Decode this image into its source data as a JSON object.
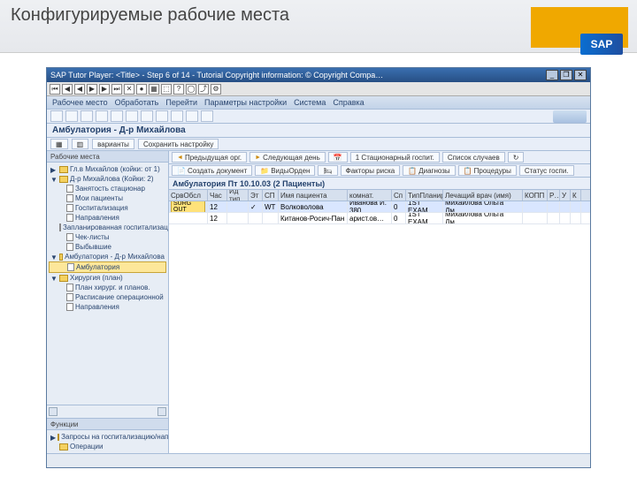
{
  "slide": {
    "title": "Конфигурируемые рабочие места",
    "brand": "SAP"
  },
  "titlebar": {
    "text": "SAP Tutor Player: <Title> - Step 6 of 14  -  Tutorial Copyright information: © Copyright Compa…",
    "min": "_",
    "max": "❐",
    "close": "✕"
  },
  "player_btns": [
    "⏮",
    "◀",
    "◀",
    "▶",
    "▶",
    "⏭",
    "✕",
    "●",
    "▦",
    "⬚",
    "?",
    "◯",
    "⤴",
    "⚙"
  ],
  "menu": [
    "Рабочее место",
    "Обработать",
    "Перейти",
    "Параметры настройки",
    "Система",
    "Справка"
  ],
  "doc_title": "Амбулатория - Д-р Михайлова",
  "extra_tb": {
    "var_label": "варианты",
    "settings_label": "Сохранить настройку"
  },
  "tree_upper_head": "Рабочие места",
  "tree_upper": [
    {
      "lvl": 0,
      "exp": "▶",
      "label": "Гл.в Михайлов (койки: от 1)"
    },
    {
      "lvl": 0,
      "exp": "▼",
      "label": "Д-р Михайлова (Койки: 2)"
    },
    {
      "lvl": 1,
      "exp": "",
      "label": "Занятость стационар"
    },
    {
      "lvl": 1,
      "exp": "",
      "label": "Мои пациенты"
    },
    {
      "lvl": 1,
      "exp": "",
      "label": "Госпитализация"
    },
    {
      "lvl": 1,
      "exp": "",
      "label": "Направления"
    },
    {
      "lvl": 1,
      "exp": "",
      "label": "Запланированная госпитализац."
    },
    {
      "lvl": 1,
      "exp": "",
      "label": "Чек-листы"
    },
    {
      "lvl": 1,
      "exp": "",
      "label": "Выбывшие"
    },
    {
      "lvl": 0,
      "exp": "▼",
      "label": "Амбулатория - Д-р Михайлова"
    },
    {
      "lvl": 1,
      "exp": "",
      "label": "Амбулатория",
      "sel": true
    },
    {
      "lvl": 0,
      "exp": "▼",
      "label": "Хирургия (план)"
    },
    {
      "lvl": 1,
      "exp": "",
      "label": "План хирург. и планов."
    },
    {
      "lvl": 1,
      "exp": "",
      "label": "Расписание операционной"
    },
    {
      "lvl": 1,
      "exp": "",
      "label": "Направления"
    }
  ],
  "tree_lower_head": "Функции",
  "tree_lower": [
    {
      "lvl": 0,
      "exp": "▶",
      "label": "Запросы на госпитализацию/направлен."
    },
    {
      "lvl": 0,
      "exp": "",
      "label": "Операции"
    }
  ],
  "content_tb1": {
    "prev": "Предыдущая орг.",
    "next": "Следующая день",
    "date_ic": "📅",
    "stationary": "1 Стационарный госпит.",
    "cases": "Список случаев",
    "refresh": "↻"
  },
  "content_tb2": {
    "create": "Создать документ",
    "viewdoc": "ВидыОрден",
    "riskfact": "Факторы риска",
    "diag": "Диагнозы",
    "proc": "Процедуры",
    "status": "Статус госпи."
  },
  "grid_title": "Амбулатория Пт 10.10.03 (2 Пациенты)",
  "grid_headers": [
    "СрвОбсл",
    "Час",
    "Ид тип",
    "Эт",
    "СП",
    "Имя пациента",
    "комнат.",
    "Сп",
    "ТипПланир",
    "Лечащий врач (имя)",
    "КОПП",
    "Р…",
    "У",
    "К"
  ],
  "grid_widths": [
    44,
    22,
    24,
    16,
    18,
    78,
    50,
    16,
    42,
    90,
    28,
    14,
    12,
    12
  ],
  "grid_rows": [
    {
      "sel": true,
      "cells": [
        "SURG OUT",
        "12",
        "",
        "✓",
        "WT",
        "Волковолова",
        "Иванова И. 380",
        "0",
        "1ST EXAM",
        "Михайлова Ольга Дм…",
        "",
        "",
        "",
        ""
      ]
    },
    {
      "sel": false,
      "cells": [
        "",
        "12",
        "",
        "",
        "",
        "Китанов-Росич-Пан",
        "арист.ов…",
        "0",
        "1ST EXAM",
        "Михайлова Ольга Дм…",
        "",
        "",
        "",
        ""
      ]
    }
  ]
}
